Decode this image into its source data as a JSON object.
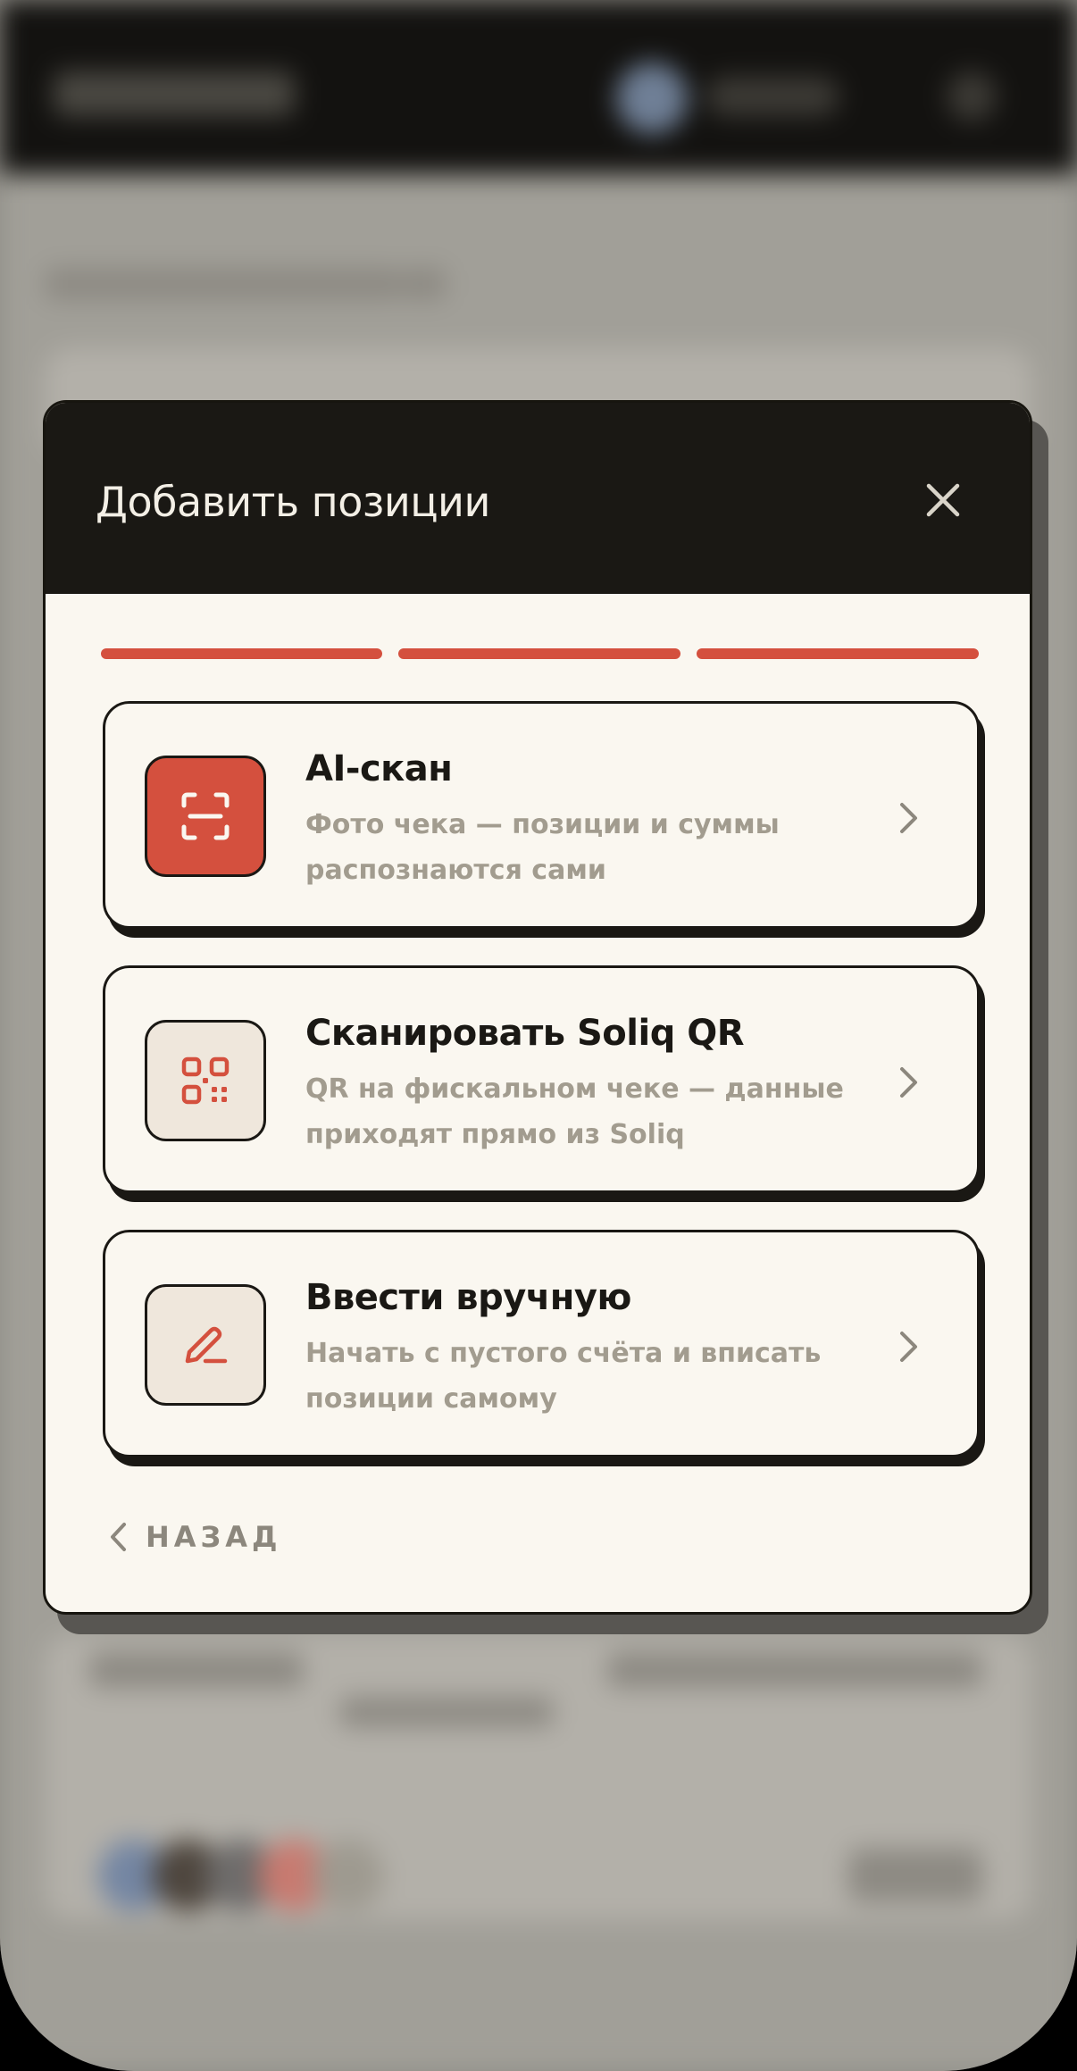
{
  "modal": {
    "title": "Добавить позиции",
    "steps_total": 3,
    "steps_completed": 3,
    "options": [
      {
        "title": "AI-скан",
        "description": "Фото чека — позиции и суммы распознаются сами",
        "icon": "scan-icon"
      },
      {
        "title": "Сканировать Soliq QR",
        "description": "QR на фискальном чеке — данные приходят прямо из Soliq",
        "icon": "qr-code-icon"
      },
      {
        "title": "Ввести вручную",
        "description": "Начать с пустого счёта и вписать позиции самому",
        "icon": "pencil-icon"
      }
    ],
    "back_label": "НАЗАД"
  },
  "colors": {
    "accent": "#d4503e",
    "header_bg": "#1a1814",
    "card_bg": "#faf7f0",
    "muted_text": "#a29c8f",
    "icon_tile_bg": "#efe7dc"
  }
}
